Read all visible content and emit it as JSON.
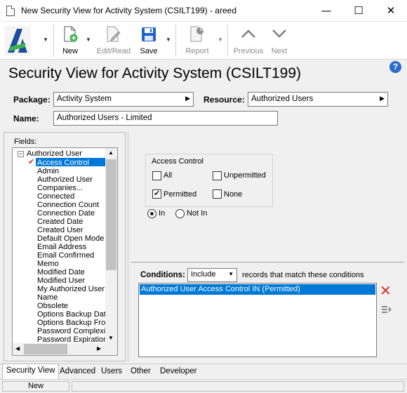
{
  "window": {
    "title": "New Security View for Activity System (CSILT199) - areed",
    "minimize": "—",
    "maximize": "☐",
    "close": "✕"
  },
  "toolbar": {
    "new": "New",
    "edit_read": "Edit/Read",
    "save": "Save",
    "report": "Report",
    "previous": "Previous",
    "next": "Next"
  },
  "page": {
    "title": "Security View for Activity System (CSILT199)",
    "help": "?"
  },
  "form": {
    "package_label": "Package:",
    "package_value": "Activity System",
    "resource_label": "Resource:",
    "resource_value": "Authorized Users",
    "name_label": "Name:",
    "name_value": "Authorized Users - Limited"
  },
  "fields": {
    "label": "Fields:",
    "root": "Authorized User",
    "items": [
      "Access Control",
      "Admin",
      "Authorized User",
      "Companies...",
      "Connected",
      "Connection Count",
      "Connection Date",
      "Created Date",
      "Created User",
      "Default Open Mode",
      "Email Address",
      "Email Confirmed",
      "Memo",
      "Modified Date",
      "Modified User",
      "My Authorized User",
      "Name",
      "Obsolete",
      "Options Backup Date",
      "Options Backup From",
      "Password Complexity",
      "Password Expiration"
    ]
  },
  "access_control": {
    "title": "Access Control",
    "all": "All",
    "unpermitted": "Unpermitted",
    "permitted": "Permitted",
    "none": "None",
    "in": "In",
    "not_in": "Not In",
    "checked": {
      "all": false,
      "unpermitted": false,
      "permitted": true,
      "none": false
    },
    "selected_mode": "In"
  },
  "conditions": {
    "label": "Conditions:",
    "mode": "Include",
    "suffix": "records that match these conditions",
    "rows": [
      "Authorized User Access Control IN (Permitted)"
    ]
  },
  "tabs": [
    "Security View",
    "Advanced",
    "Users",
    "Other",
    "Developer"
  ],
  "active_tab": "Security View",
  "status": {
    "mode": "New"
  },
  "colors": {
    "selection": "#0078d7",
    "logo_green": "#3cb44b",
    "logo_blue": "#1d4e9e",
    "delete_red": "#d8322a",
    "save_blue": "#1f63c6"
  }
}
